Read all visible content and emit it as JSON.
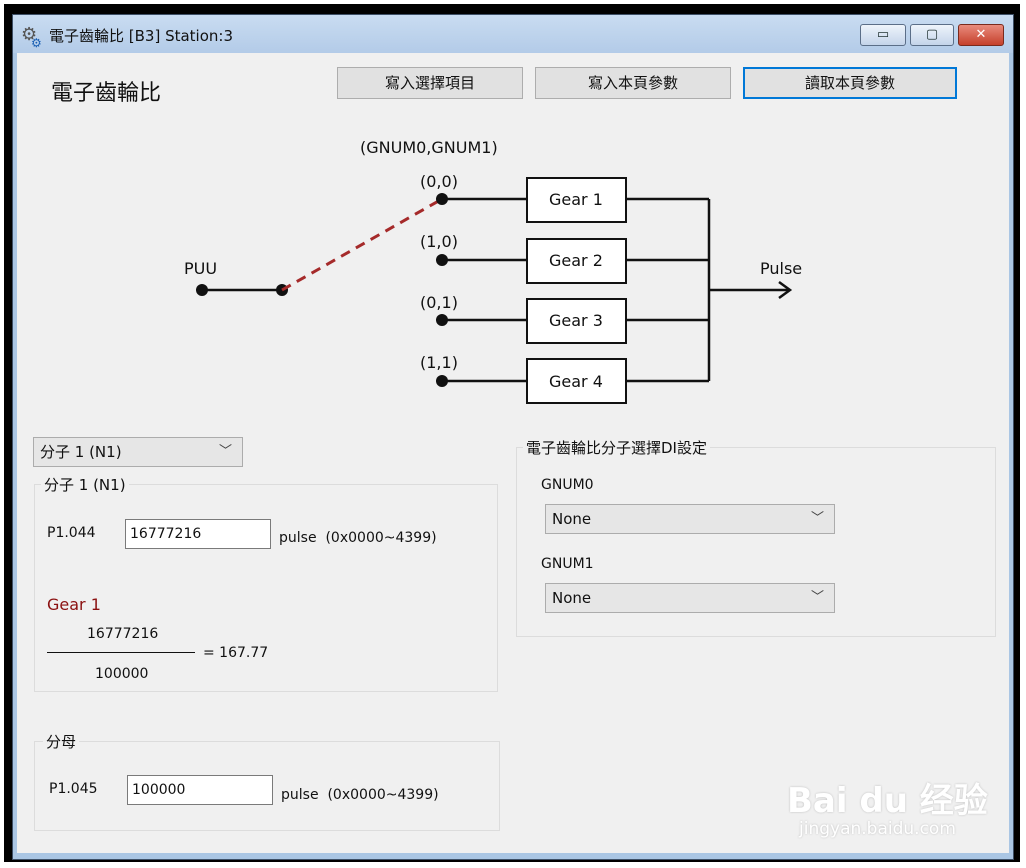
{
  "window": {
    "title": "電子齒輪比 [B3] Station:3",
    "controls": {
      "minimize": "▭",
      "maximize": "▢",
      "close": "✕"
    }
  },
  "page": {
    "heading": "電子齒輪比",
    "buttons": {
      "write_selected": "寫入選擇項目",
      "write_page": "寫入本頁參數",
      "read_page": "讀取本頁參數"
    }
  },
  "diagram": {
    "header": "(GNUM0,GNUM1)",
    "input_label": "PUU",
    "output_label": "Pulse",
    "branches": [
      {
        "code": "(0,0)",
        "gear": "Gear 1"
      },
      {
        "code": "(1,0)",
        "gear": "Gear 2"
      },
      {
        "code": "(0,1)",
        "gear": "Gear 3"
      },
      {
        "code": "(1,1)",
        "gear": "Gear 4"
      }
    ],
    "active_branch": "Gear 1",
    "colors": {
      "switch": "#a52a2a",
      "line": "#111111"
    }
  },
  "numerator": {
    "select_value": "分子 1 (N1)",
    "group_label": "分子 1 (N1)",
    "param_name": "P1.044",
    "value": "16777216",
    "unit": "pulse",
    "range": "(0x0000~4399)",
    "gear_label": "Gear 1",
    "fraction_top": "16777216",
    "fraction_bottom": "100000",
    "result": "= 167.77"
  },
  "denominator": {
    "group_label": "分母",
    "param_name": "P1.045",
    "value": "100000",
    "unit": "pulse",
    "range": "(0x0000~4399)"
  },
  "di_settings": {
    "group_label": "電子齒輪比分子選擇DI設定",
    "gnum0_label": "GNUM0",
    "gnum0_value": "None",
    "gnum1_label": "GNUM1",
    "gnum1_value": "None"
  },
  "watermark": {
    "brand": "Bai du 经验",
    "url": "jingyan.baidu.com"
  }
}
